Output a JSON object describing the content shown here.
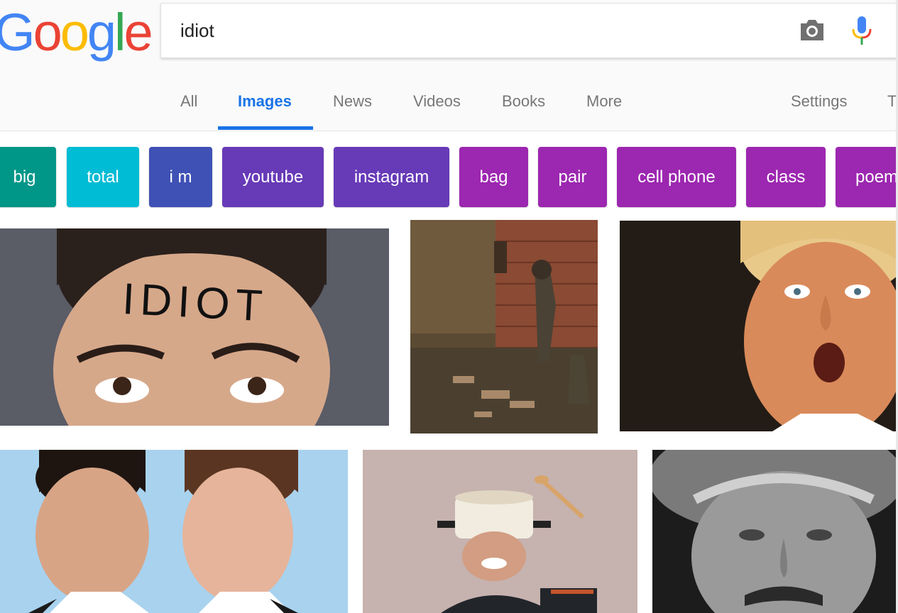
{
  "logo": {
    "letters": [
      "G",
      "o",
      "o",
      "g",
      "l",
      "e"
    ],
    "colors": [
      "#4285F4",
      "#EA4335",
      "#FBBC05",
      "#4285F4",
      "#34A853",
      "#EA4335"
    ]
  },
  "search": {
    "query": "idiot",
    "camera_icon": "camera-icon",
    "mic_icon": "microphone-icon"
  },
  "tabs": [
    {
      "label": "All",
      "active": false
    },
    {
      "label": "Images",
      "active": true
    },
    {
      "label": "News",
      "active": false
    },
    {
      "label": "Videos",
      "active": false
    },
    {
      "label": "Books",
      "active": false
    },
    {
      "label": "More",
      "active": false
    }
  ],
  "settings": {
    "label": "Settings",
    "tools_label_partial": "T"
  },
  "accent_color": "#1a73e8",
  "chips": [
    {
      "label": "big",
      "color": "#009688"
    },
    {
      "label": "total",
      "color": "#00BCD4"
    },
    {
      "label": "i m",
      "color": "#3F51B5"
    },
    {
      "label": "youtube",
      "color": "#673AB7"
    },
    {
      "label": "instagram",
      "color": "#673AB7"
    },
    {
      "label": "bag",
      "color": "#9C27B0"
    },
    {
      "label": "pair",
      "color": "#9C27B0"
    },
    {
      "label": "cell phone",
      "color": "#9C27B0"
    },
    {
      "label": "class",
      "color": "#9C27B0"
    },
    {
      "label": "poem",
      "color": "#9C27B0"
    }
  ],
  "images": {
    "forehead_text": "IDIOT"
  }
}
